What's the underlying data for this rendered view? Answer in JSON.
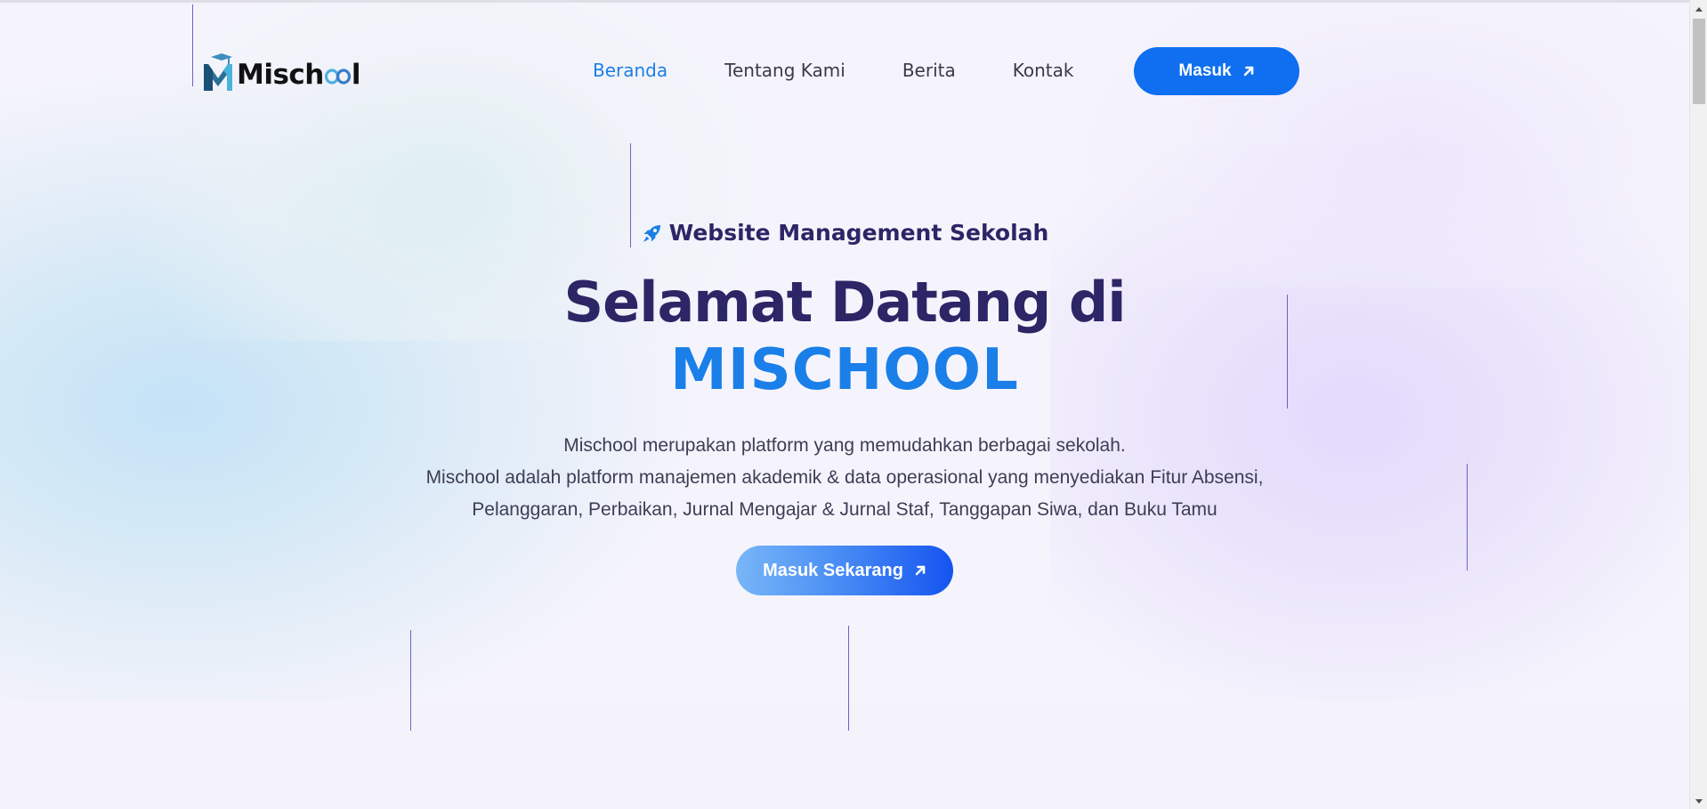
{
  "brand": {
    "name_prefix": "Misch",
    "name_suffix": "l",
    "logo_icon": "mischool-logo-icon"
  },
  "nav": {
    "items": [
      {
        "label": "Beranda",
        "active": true
      },
      {
        "label": "Tentang Kami",
        "active": false
      },
      {
        "label": "Berita",
        "active": false
      },
      {
        "label": "Kontak",
        "active": false
      }
    ],
    "login_label": "Masuk",
    "login_icon": "arrow-up-right-icon"
  },
  "hero": {
    "tagline": "Website Management Sekolah",
    "tagline_icon": "rocket-icon",
    "headline": "Selamat Datang di",
    "headline_accent": "MISCHOOL",
    "description_lines": [
      "Mischool merupakan platform yang memudahkan berbagai sekolah.",
      "Mischool adalah platform manajemen akademik & data operasional yang menyediakan Fitur Absensi,",
      "Pelanggaran, Perbaikan, Jurnal Mengajar & Jurnal Staf, Tanggapan Siwa, dan Buku Tamu"
    ],
    "cta_label": "Masuk Sekarang",
    "cta_icon": "arrow-up-right-icon"
  },
  "colors": {
    "primary": "#0f6ff0",
    "accent_text": "#1a7fe8",
    "heading": "#2c2566",
    "body_text": "#3d3d55",
    "background": "#f5f4fc"
  }
}
